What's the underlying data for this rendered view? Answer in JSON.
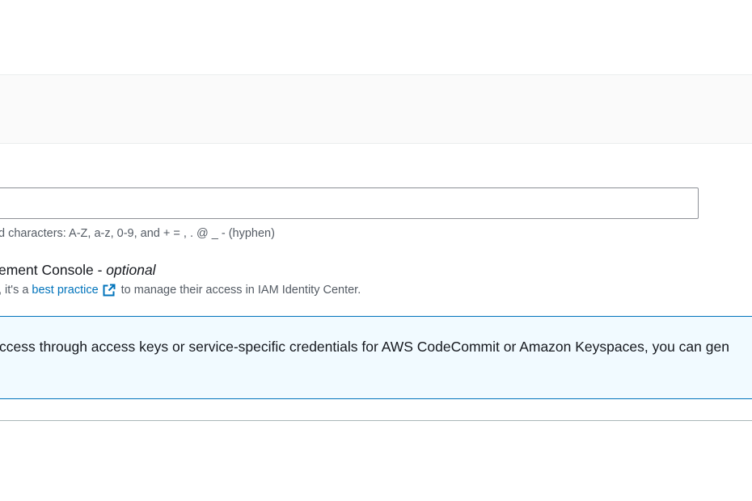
{
  "user_name_field": {
    "value": "",
    "placeholder": ""
  },
  "user_name_constraint": "d characters: A-Z, a-z, 0-9, and + = , . @ _ - (hyphen)",
  "console_access": {
    "label": "ement Console - ",
    "optional_label": "optional",
    "description_prefix": ", it's a",
    "link_text": "best practice",
    "link_icon": "external-link-icon",
    "description_suffix": "to manage their access in IAM Identity Center."
  },
  "info_alert": {
    "text": "ccess through access keys or service-specific credentials for AWS CodeCommit or Amazon Keyspaces, you can gen"
  },
  "colors": {
    "link": "#0073bb",
    "info_background": "#f1faff",
    "info_border": "#0073bb",
    "secondary_text": "#545b64"
  }
}
